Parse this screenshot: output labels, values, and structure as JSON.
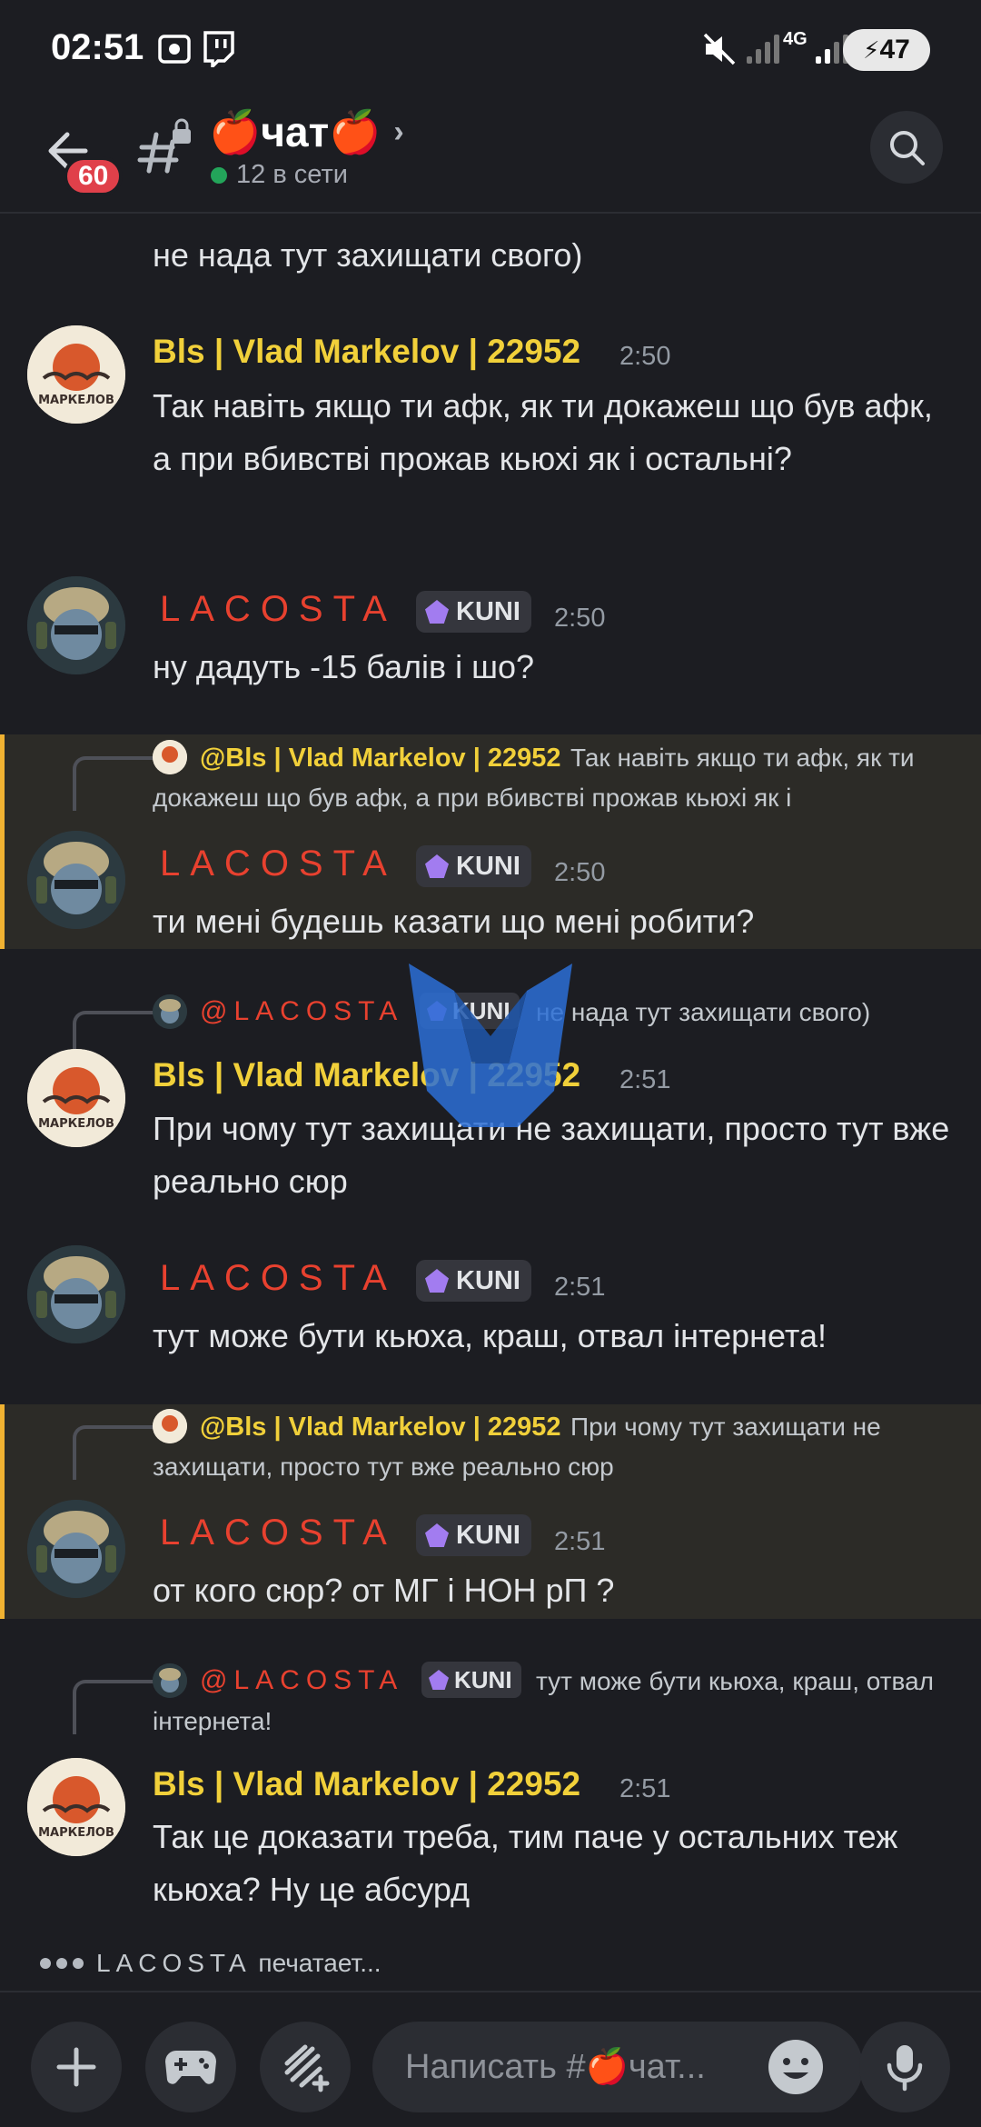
{
  "status_bar": {
    "time": "02:51",
    "battery": "47",
    "network": "4G"
  },
  "header": {
    "unread_badge": "60",
    "channel_name": "🍎чат🍎",
    "online_status": "12 в сети"
  },
  "messages": {
    "m0": {
      "text": "не нада тут захищати свого)"
    },
    "m1": {
      "author": "Bls | Vlad Markelov | 22952",
      "time": "2:50",
      "text": "Так навіть якщо ти афк, як ти докажеш що був афк, а при вбивстві прожав кьюхі як і остальні?"
    },
    "m2": {
      "author": "LACOSTA",
      "tag": "KUNI",
      "time": "2:50",
      "text": "ну дадуть -15 балів і шо?"
    },
    "m3": {
      "reply_author": "@Bls | Vlad Markelov | 22952",
      "reply_text": "Так навіть якщо ти афк, як ти докажеш що був афк, а при вбивстві прожав кьюхі як і",
      "author": "LACOSTA",
      "tag": "KUNI",
      "time": "2:50",
      "text": "ти мені будешь казати що мені робити?"
    },
    "m4": {
      "reply_author": "@LACOSTA",
      "reply_tag": "KUNI",
      "reply_text": "не нада тут захищати свого)",
      "author": "Bls | Vlad Markelov | 22952",
      "time": "2:51",
      "text": "При чому тут захищати не захищати, просто тут вже реально сюр"
    },
    "m5": {
      "author": "LACOSTA",
      "tag": "KUNI",
      "time": "2:51",
      "text": "тут може бути кьюха, краш, отвал інтернета!"
    },
    "m6": {
      "reply_author": "@Bls | Vlad Markelov | 22952",
      "reply_text": "При чому тут захищати не захищати, просто тут вже реально сюр",
      "author": "LACOSTA",
      "tag": "KUNI",
      "time": "2:51",
      "text": "от кого сюр? от МГ  і НОН рП ?"
    },
    "m7": {
      "reply_author": "@LACOSTA",
      "reply_tag": "KUNI",
      "reply_text": "тут може бути кьюха, краш, отвал інтернета!",
      "author": "Bls | Vlad Markelov | 22952",
      "time": "2:51",
      "text": "Так це доказати треба, тим паче у остальних теж кьюха? Ну це абсурд"
    }
  },
  "typing": {
    "name": "LACOSTA",
    "label": "печатает..."
  },
  "composer": {
    "placeholder": "Написать #🍎чат..."
  },
  "avatar_label": "МАРКЕЛОВ",
  "colors": {
    "background": "#1c1d22",
    "markelov_name": "#f1d03a",
    "lacosta_name": "#e8412f",
    "mention_bar": "#f0b232",
    "online": "#23a55a",
    "badge": "#e0404a"
  },
  "icons": [
    "back-arrow-icon",
    "channel-hash-lock-icon",
    "chevron-right-icon",
    "search-icon",
    "plus-icon",
    "gamepad-icon",
    "apps-icon",
    "emoji-icon",
    "microphone-icon"
  ]
}
